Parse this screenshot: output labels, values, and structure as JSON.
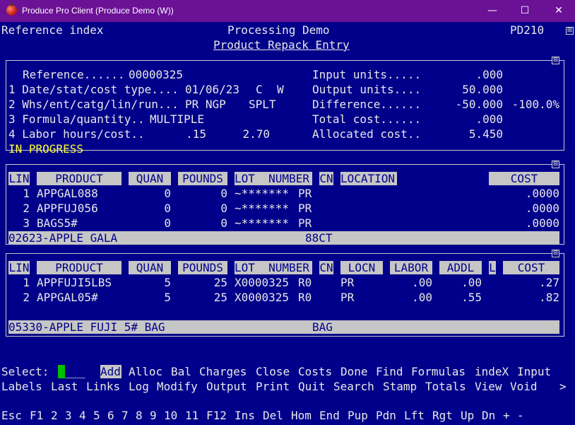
{
  "window": {
    "title": "Produce Pro Client (Produce Demo (W))",
    "minimize": "—",
    "maximize": "☐",
    "close": "✕"
  },
  "header": {
    "left": "Reference index",
    "center": "Processing Demo",
    "screen_id": "PD210",
    "subtitle": "Product Repack Entry",
    "close_glyph": "⊠"
  },
  "entry": {
    "ref_label": "Reference......",
    "ref_value": "00000325",
    "line1_label": "1 Date/stat/cost type....",
    "date": "01/06/23",
    "stat": "C",
    "cost_type": "W",
    "line2_label": "2 Whs/ent/catg/lin/run...",
    "whs": "PR NGP",
    "run": "SPLT",
    "line3_label": "3 Formula/quantity..",
    "formula": "MULTIPLE",
    "line4_label": "4 Labor hours/cost..",
    "labor_hours": ".15",
    "labor_cost": "2.70",
    "input_units_label": "Input units.....",
    "input_units": ".000",
    "output_units_label": "Output units....",
    "output_units": "50.000",
    "difference_label": "Difference......",
    "difference": "-50.000",
    "difference_pct": "-100.0%",
    "total_cost_label": "Total cost......",
    "total_cost": ".000",
    "allocated_cost_label": "Allocated cost..",
    "allocated_cost": "5.450",
    "status": "IN PROGRESS"
  },
  "inputs": {
    "headers": {
      "lin": "LIN",
      "product": "PRODUCT",
      "quan": "QUAN",
      "pounds": "POUNDS",
      "lot": "LOT  NUMBER",
      "cn": "CN",
      "location": "LOCATION",
      "cost": "COST"
    },
    "rows": [
      {
        "lin": "1",
        "product": "APPGAL088",
        "quan": "0",
        "pounds": "0",
        "lot": "~*******",
        "cn": "PR",
        "cost": ".0000"
      },
      {
        "lin": "2",
        "product": "APPFUJ056",
        "quan": "0",
        "pounds": "0",
        "lot": "~*******",
        "cn": "PR",
        "cost": ".0000"
      },
      {
        "lin": "3",
        "product": "BAGS5#",
        "quan": "0",
        "pounds": "0",
        "lot": "~*******",
        "cn": "PR",
        "cost": ".0000"
      }
    ],
    "status_left": "02623-APPLE GALA",
    "status_right": "88CT"
  },
  "outputs": {
    "headers": {
      "lin": "LIN",
      "product": "PRODUCT",
      "quan": "QUAN",
      "pounds": "POUNDS",
      "lot": "LOT  NUMBER",
      "cn": "CN",
      "locn": "LOCN",
      "labor": "LABOR",
      "addl": "ADDL",
      "l": "L",
      "cost": "COST"
    },
    "rows": [
      {
        "lin": "1",
        "product": "APPFUJI5LBS",
        "quan": "5",
        "pounds": "25",
        "lot": "X0000325",
        "lotcode": "R0",
        "locn": "PR",
        "labor": ".00",
        "addl": ".00",
        "cost": ".27"
      },
      {
        "lin": "2",
        "product": "APPGAL05#",
        "quan": "5",
        "pounds": "25",
        "lot": "X0000325",
        "lotcode": "R0",
        "locn": "PR",
        "labor": ".00",
        "addl": ".55",
        "cost": ".82"
      }
    ],
    "status_left": "05330-APPLE FUJI 5# BAG",
    "status_right": "BAG"
  },
  "command": {
    "prompt": "Select:",
    "input_rest": "___",
    "commands_line1": [
      "Add",
      "Alloc",
      "Bal",
      "Charges",
      "Close",
      "Costs",
      "Done",
      "Find",
      "Formulas",
      "indeX",
      "Input"
    ],
    "commands_line2": [
      "Labels",
      "Last",
      "Links",
      "Log",
      "Modify",
      "Output",
      "Print",
      "Quit",
      "Search",
      "Stamp",
      "Totals",
      "View",
      "Void"
    ],
    "more": ">"
  },
  "fkeys": [
    "Esc",
    "F1",
    "2",
    "3",
    "4",
    "5",
    "6",
    "7",
    "8",
    "9",
    "10",
    "11",
    "F12",
    "Ins",
    "Del",
    "Hom",
    "End",
    "Pup",
    "Pdn",
    "Lft",
    "Rgt",
    "Up",
    "Dn",
    "+",
    "-"
  ]
}
